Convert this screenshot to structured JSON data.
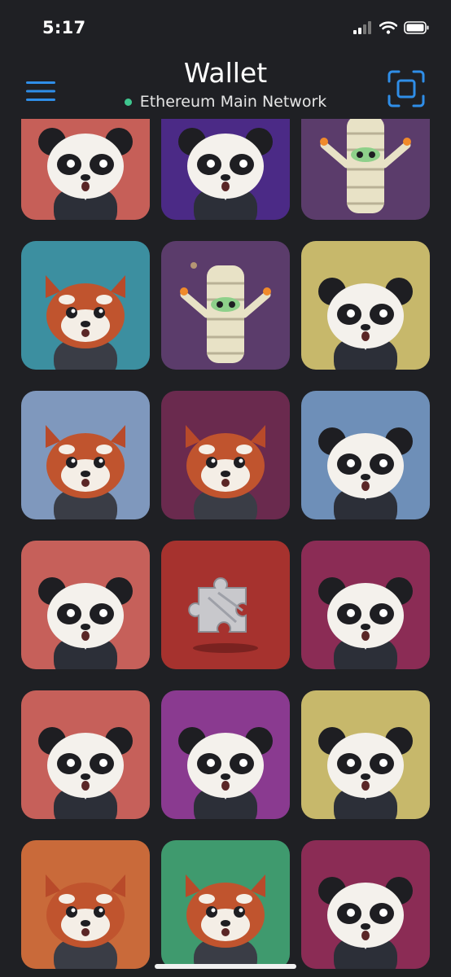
{
  "status_bar": {
    "time": "5:17"
  },
  "header": {
    "title": "Wallet",
    "network": "Ethereum Main Network",
    "network_status_color": "#3fc68f",
    "accent_color": "#2f8ee8"
  },
  "collectibles": [
    {
      "character": "panda",
      "bg": "#c65f58"
    },
    {
      "character": "panda",
      "bg": "#4b2a86"
    },
    {
      "character": "mummy",
      "bg": "#5b3c6b"
    },
    {
      "character": "red-panda",
      "bg": "#3c8fa0"
    },
    {
      "character": "mummy",
      "bg": "#5b3c6b"
    },
    {
      "character": "panda",
      "bg": "#c7b86b"
    },
    {
      "character": "red-panda",
      "bg": "#7f98bd"
    },
    {
      "character": "red-panda",
      "bg": "#6a2a4e"
    },
    {
      "character": "panda",
      "bg": "#6e8fb8"
    },
    {
      "character": "panda",
      "bg": "#c6605a"
    },
    {
      "character": "puzzle",
      "bg": "#a6322e"
    },
    {
      "character": "panda",
      "bg": "#8b2c55"
    },
    {
      "character": "panda",
      "bg": "#c6605a"
    },
    {
      "character": "panda",
      "bg": "#8a3a90"
    },
    {
      "character": "panda",
      "bg": "#c7b86b"
    },
    {
      "character": "red-panda",
      "bg": "#c96a3a"
    },
    {
      "character": "red-panda",
      "bg": "#3f9a6e"
    },
    {
      "character": "panda",
      "bg": "#8b2c55"
    }
  ]
}
